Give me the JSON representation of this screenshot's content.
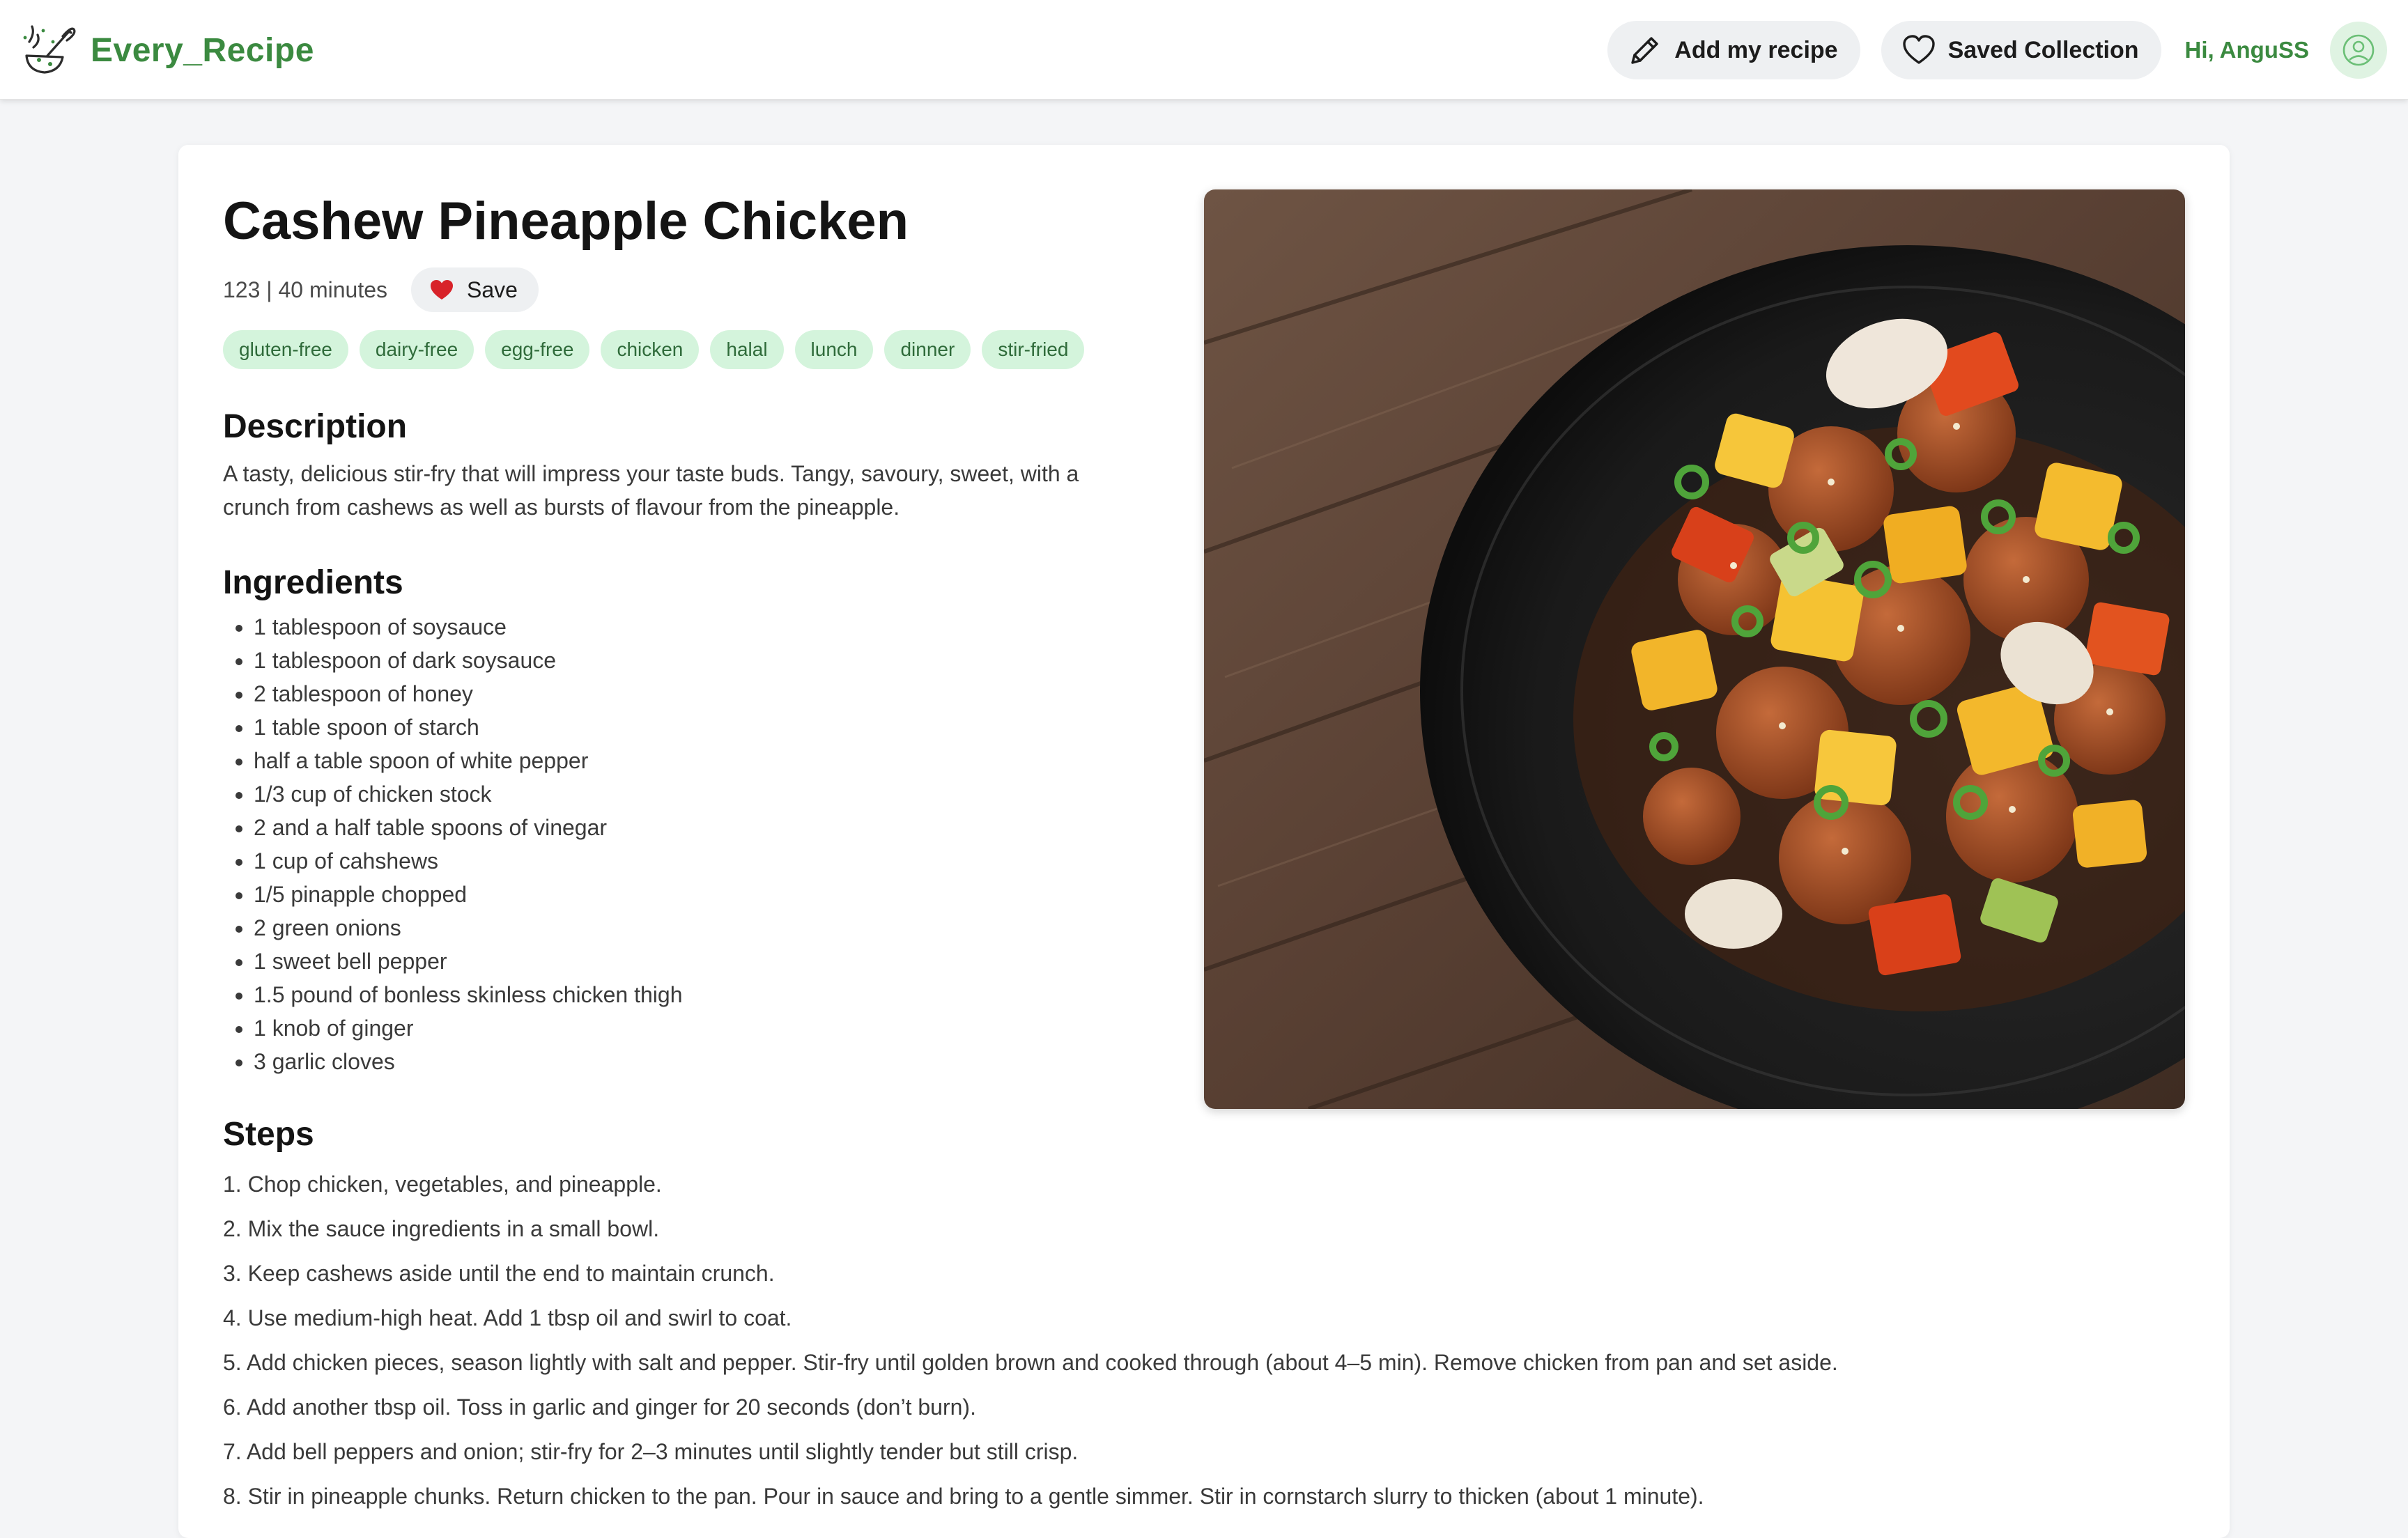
{
  "header": {
    "brand_name": "Every_Recipe",
    "logo_icon": "whisk-bowl-icon",
    "add_recipe_label": "Add my recipe",
    "add_recipe_icon": "pencil-icon",
    "saved_collection_label": "Saved Collection",
    "saved_collection_icon": "heart-outline-icon",
    "greeting": "Hi, AnguSS",
    "avatar_icon": "user-circle-icon"
  },
  "recipe": {
    "title": "Cashew Pineapple Chicken",
    "meta": "123 | 40 minutes",
    "save_label": "Save",
    "save_icon": "heart-filled-icon",
    "tags": [
      "gluten-free",
      "dairy-free",
      "egg-free",
      "chicken",
      "halal",
      "lunch",
      "dinner",
      "stir-fried"
    ],
    "description_heading": "Description",
    "description": "A tasty, delicious stir-fry that will impress your taste buds. Tangy, savoury, sweet, with a crunch from cashews as well as bursts of flavour from the pineapple.",
    "ingredients_heading": "Ingredients",
    "ingredients": [
      "1 tablespoon of soysauce",
      "1 tablespoon of dark soysauce",
      "2 tablespoon of honey",
      "1 table spoon of starch",
      "half a table spoon of white pepper",
      "1/3 cup of chicken stock",
      "2 and a half table spoons of vinegar",
      "1 cup of cahshews",
      "1/5 pinapple chopped",
      "2 green onions",
      "1 sweet bell pepper",
      "1.5 pound of bonless skinless chicken thigh",
      "1 knob of ginger",
      "3 garlic cloves"
    ],
    "steps_heading": "Steps",
    "steps": [
      "1. Chop chicken, vegetables, and pineapple.",
      "2. Mix the sauce ingredients in a small bowl.",
      "3. Keep cashews aside until the end to maintain crunch.",
      "4. Use medium-high heat. Add 1 tbsp oil and swirl to coat.",
      "5. Add chicken pieces, season lightly with salt and pepper. Stir-fry until golden brown and cooked through (about 4–5 min). Remove chicken from pan and set aside.",
      "6. Add another tbsp oil. Toss in garlic and ginger for 20 seconds (don’t burn).",
      "7. Add bell peppers and onion; stir-fry for 2–3 minutes until slightly tender but still crisp.",
      "8. Stir in pineapple chunks. Return chicken to the pan. Pour in sauce and bring to a gentle simmer. Stir in cornstarch slurry to thicken (about 1 minute)."
    ],
    "photo_subject": "food-photo"
  },
  "colors": {
    "brand_green": "#3b8a40",
    "tag_bg": "#d4f4dc",
    "tag_text": "#2f6b3a",
    "pill_bg": "#eef0f2",
    "page_bg": "#f4f5f7",
    "heart_red": "#d8232a"
  }
}
